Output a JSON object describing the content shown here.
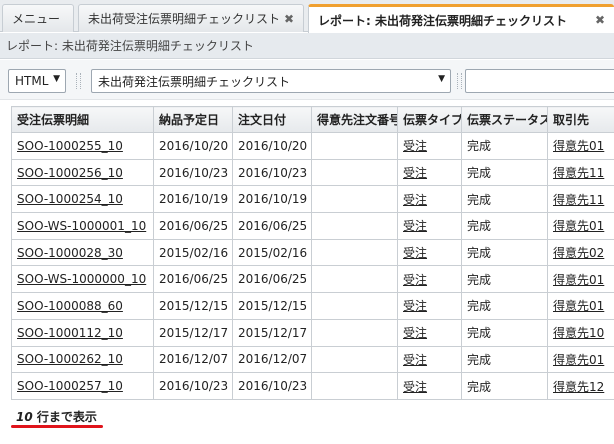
{
  "tabs": [
    {
      "label": "メニュー",
      "closable": false
    },
    {
      "label": "未出荷受注伝票明細チェックリスト",
      "closable": true
    },
    {
      "label": "レポート: 未出荷発注伝票明細チェックリスト",
      "closable": true,
      "active": true
    }
  ],
  "close_glyph": "✖",
  "page_title": "レポート: 未出荷発注伝票明細チェックリスト",
  "toolbar": {
    "format_value": "HTML",
    "report_value": "未出荷発注伝票明細チェックリスト",
    "dropdown_glyph": "▼"
  },
  "table": {
    "headers": [
      "受注伝票明細",
      "納品予定日",
      "注文日付",
      "得意先注文番号",
      "伝票タイプ",
      "伝票ステータス",
      "取引先"
    ],
    "rows": [
      [
        "SOO-1000255_10",
        "2016/10/20",
        "2016/10/20",
        "",
        "受注",
        "完成",
        "得意先01"
      ],
      [
        "SOO-1000256_10",
        "2016/10/23",
        "2016/10/23",
        "",
        "受注",
        "完成",
        "得意先11"
      ],
      [
        "SOO-1000254_10",
        "2016/10/19",
        "2016/10/19",
        "",
        "受注",
        "完成",
        "得意先11"
      ],
      [
        "SOO-WS-1000001_10",
        "2016/06/25",
        "2016/06/25",
        "",
        "受注",
        "完成",
        "得意先01"
      ],
      [
        "SOO-1000028_30",
        "2015/02/16",
        "2015/02/16",
        "",
        "受注",
        "完成",
        "得意先02"
      ],
      [
        "SOO-WS-1000000_10",
        "2016/06/25",
        "2016/06/25",
        "",
        "受注",
        "完成",
        "得意先01"
      ],
      [
        "SOO-1000088_60",
        "2015/12/15",
        "2015/12/15",
        "",
        "受注",
        "完成",
        "得意先01"
      ],
      [
        "SOO-1000112_10",
        "2015/12/17",
        "2015/12/17",
        "",
        "受注",
        "完成",
        "得意先10"
      ],
      [
        "SOO-1000262_10",
        "2016/12/07",
        "2016/12/07",
        "",
        "受注",
        "完成",
        "得意先01"
      ],
      [
        "SOO-1000257_10",
        "2016/10/23",
        "2016/10/23",
        "",
        "受注",
        "完成",
        "得意先12"
      ]
    ]
  },
  "footer": {
    "count": "10",
    "suffix": " 行まで表示"
  },
  "colors": {
    "active_tab_accent": "#f0a030",
    "highlight_underline": "#e0141b"
  }
}
